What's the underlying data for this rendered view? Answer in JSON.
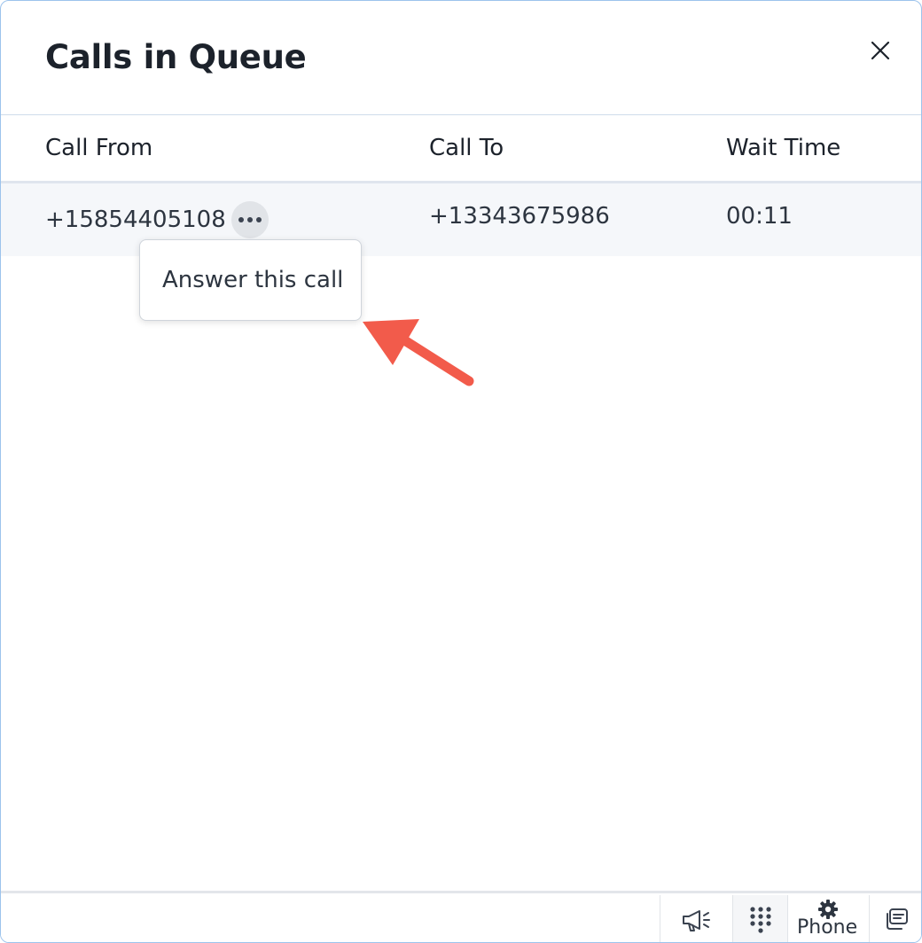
{
  "dialog": {
    "title": "Calls in Queue",
    "close_icon": "close-icon"
  },
  "table": {
    "columns": [
      "Call From",
      "Call To",
      "Wait Time"
    ],
    "rows": [
      {
        "call_from": "+15854405108",
        "call_to": "+13343675986",
        "wait_time": "00:11"
      }
    ]
  },
  "row_menu": {
    "icon": "more-horizontal-icon",
    "items": [
      "Answer this call"
    ]
  },
  "annotation": {
    "icon": "pointer-arrow-icon",
    "color": "#f25b4b"
  },
  "footer": {
    "buttons": [
      {
        "icon": "megaphone-icon"
      },
      {
        "icon": "dialpad-icon"
      },
      {
        "icon": "gear-icon",
        "label": "Phone"
      },
      {
        "icon": "chat-history-icon"
      }
    ]
  }
}
